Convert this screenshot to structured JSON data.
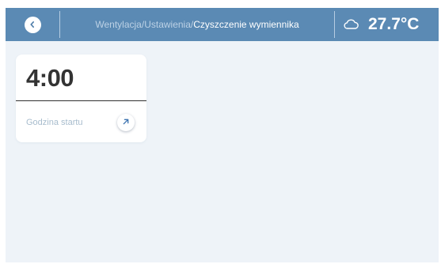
{
  "header": {
    "back_icon": "chevron-left-icon",
    "breadcrumb": {
      "part1": "Wentylacja",
      "sep1": "/",
      "part2": "Ustawienia",
      "sep2": "/",
      "current": "Czyszczenie wymiennika"
    },
    "weather_icon": "cloud-icon",
    "temperature": "27.7°C"
  },
  "card": {
    "value": "4:00",
    "label": "Godzina startu",
    "arrow_icon": "arrow-up-right-icon"
  },
  "colors": {
    "header_bg": "#5b8ab4",
    "content_bg": "#eef3f8",
    "accent": "#3d73b0",
    "card_bg": "#ffffff"
  }
}
